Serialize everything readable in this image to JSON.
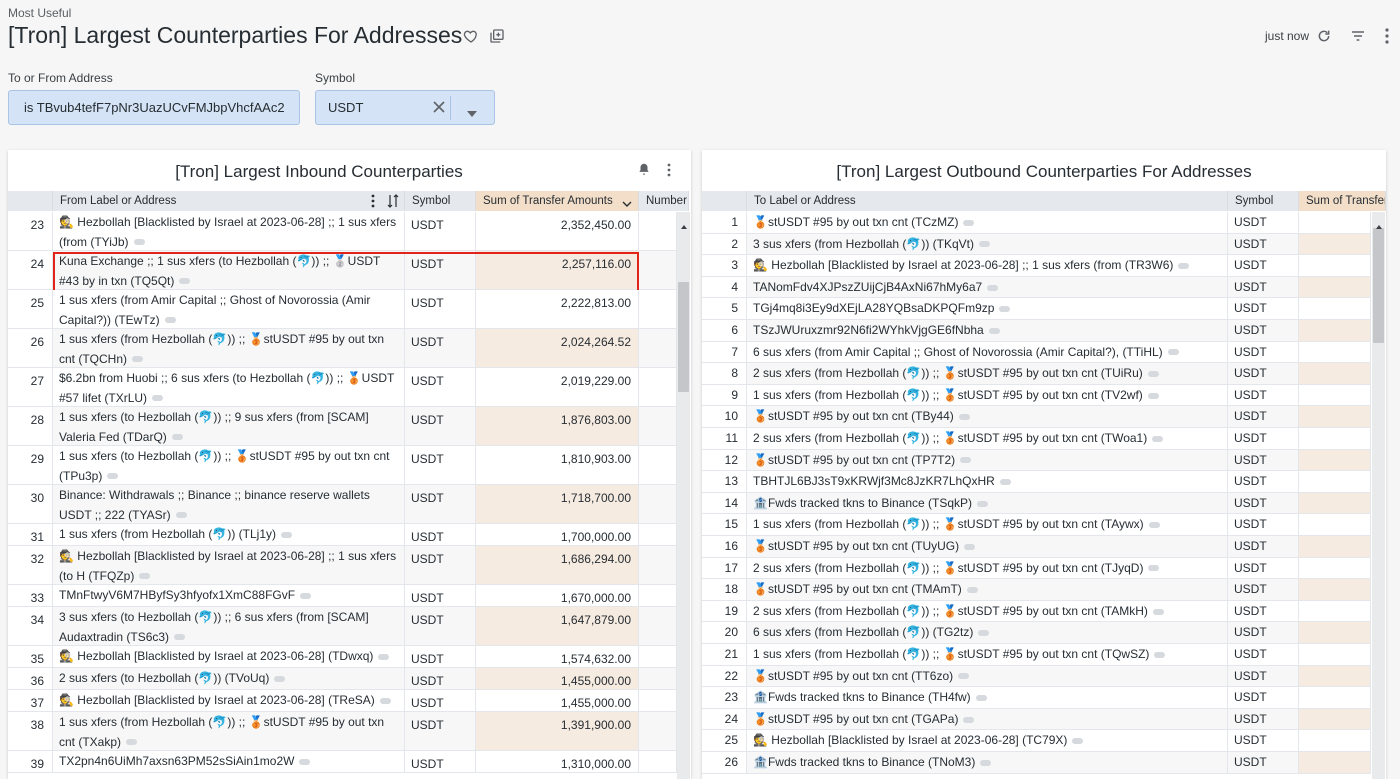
{
  "header": {
    "breadcrumb": "Most Useful",
    "title": "[Tron] Largest Counterparties For Addresses",
    "updated": "just now",
    "icons": [
      "heart-icon",
      "copy-icon",
      "refresh-icon",
      "filter-icon",
      "more-vert-icon"
    ]
  },
  "filters": {
    "address": {
      "label": "To or From Address",
      "value": "is TBvub4tefF7pNr3UazUCvFMJbpVhcfAAc2"
    },
    "symbol": {
      "label": "Symbol",
      "value": "USDT"
    }
  },
  "inbound": {
    "title": "[Tron] Largest Inbound Counterparties",
    "columns": [
      "From Label or Address",
      "Symbol",
      "Sum of Transfer Amounts",
      "Number o"
    ],
    "rows": [
      {
        "i": "23",
        "label": "🕵 Hezbollah [Blacklisted by Israel at 2023-06-28] ;; 1 sus xfers (from (TYiJb)",
        "sym": "USDT",
        "amt": "2,352,450.00",
        "lines": 2
      },
      {
        "i": "24",
        "label": "Kuna Exchange ;; 1 sus xfers (to Hezbollah (🐬)) ;; 🥈USDT #43 by in txn (TQ5Qt)",
        "sym": "USDT",
        "amt": "2,257,116.00",
        "lines": 2
      },
      {
        "i": "25",
        "label": "1 sus xfers (from Amir Capital ;; Ghost of Novorossia (Amir Capital?)) (TEwTz)",
        "sym": "USDT",
        "amt": "2,222,813.00",
        "lines": 2
      },
      {
        "i": "26",
        "label": "1 sus xfers (from Hezbollah (🐬)) ;; 🥉stUSDT #95 by out txn cnt (TQCHn)",
        "sym": "USDT",
        "amt": "2,024,264.52",
        "lines": 2
      },
      {
        "i": "27",
        "label": "$6.2bn from Huobi ;; 6 sus xfers (to Hezbollah (🐬)) ;; 🥉USDT #57 lifet (TXrLU)",
        "sym": "USDT",
        "amt": "2,019,229.00",
        "lines": 2
      },
      {
        "i": "28",
        "label": "1 sus xfers (to Hezbollah (🐬)) ;; 9 sus xfers (from [SCAM] Valeria Fed (TDarQ)",
        "sym": "USDT",
        "amt": "1,876,803.00",
        "lines": 2
      },
      {
        "i": "29",
        "label": "1 sus xfers (to Hezbollah (🐬)) ;; 🥉stUSDT #95 by out txn cnt (TPu3p)",
        "sym": "USDT",
        "amt": "1,810,903.00",
        "lines": 2
      },
      {
        "i": "30",
        "label": "Binance: Withdrawals ;; Binance ;; binance reserve wallets USDT ;; 222 (TYASr)",
        "sym": "USDT",
        "amt": "1,718,700.00",
        "lines": 2
      },
      {
        "i": "31",
        "label": "1 sus xfers (from Hezbollah (🐬)) (TLj1y)",
        "sym": "USDT",
        "amt": "1,700,000.00",
        "lines": 1
      },
      {
        "i": "32",
        "label": "🕵 Hezbollah [Blacklisted by Israel at 2023-06-28] ;; 1 sus xfers (to H (TFQZp)",
        "sym": "USDT",
        "amt": "1,686,294.00",
        "lines": 2
      },
      {
        "i": "33",
        "label": "TMnFtwyV6M7HByfSy3hfyofx1XmC88FGvF",
        "sym": "USDT",
        "amt": "1,670,000.00",
        "lines": 1
      },
      {
        "i": "34",
        "label": "3 sus xfers (to Hezbollah (🐬)) ;; 6 sus xfers (from [SCAM] Audaxtradin (TS6c3)",
        "sym": "USDT",
        "amt": "1,647,879.00",
        "lines": 2
      },
      {
        "i": "35",
        "label": "🕵 Hezbollah [Blacklisted by Israel at 2023-06-28] (TDwxq)",
        "sym": "USDT",
        "amt": "1,574,632.00",
        "lines": 1
      },
      {
        "i": "36",
        "label": "2 sus xfers (to Hezbollah (🐬)) (TVoUq)",
        "sym": "USDT",
        "amt": "1,455,000.00",
        "lines": 1
      },
      {
        "i": "37",
        "label": "🕵 Hezbollah [Blacklisted by Israel at 2023-06-28] (TReSA)",
        "sym": "USDT",
        "amt": "1,455,000.00",
        "lines": 1
      },
      {
        "i": "38",
        "label": "1 sus xfers (from Hezbollah (🐬)) ;; 🥉stUSDT #95 by out txn cnt (TXakp)",
        "sym": "USDT",
        "amt": "1,391,900.00",
        "lines": 2
      },
      {
        "i": "39",
        "label": "TX2pn4n6UiMh7axsn63PM52sSiAin1mo2W",
        "sym": "USDT",
        "amt": "1,310,000.00",
        "lines": 1
      }
    ]
  },
  "outbound": {
    "title": "[Tron] Largest Outbound Counterparties For Addresses",
    "columns": [
      "To Label or Address",
      "Symbol",
      "Sum of Transfer"
    ],
    "rows": [
      {
        "i": "1",
        "label": "🥉stUSDT #95 by out txn cnt (TCzMZ)",
        "sym": "USDT"
      },
      {
        "i": "2",
        "label": "3 sus xfers (from Hezbollah (🐬)) (TKqVt)",
        "sym": "USDT"
      },
      {
        "i": "3",
        "label": "🕵 Hezbollah [Blacklisted by Israel at 2023-06-28] ;; 1 sus xfers (from (TR3W6)",
        "sym": "USDT"
      },
      {
        "i": "4",
        "label": "TANomFdv4XJPszZUijCjB4AxNi67hMy6a7",
        "sym": "USDT"
      },
      {
        "i": "5",
        "label": "TGj4mq8i3Ey9dXEjLA28YQBsaDKPQFm9zp",
        "sym": "USDT"
      },
      {
        "i": "6",
        "label": "TSzJWUruxzmr92N6fi2WYhkVjgGE6fNbha",
        "sym": "USDT"
      },
      {
        "i": "7",
        "label": "6 sus xfers (from Amir Capital ;; Ghost of Novorossia (Amir Capital?), (TTiHL)",
        "sym": "USDT"
      },
      {
        "i": "8",
        "label": "2 sus xfers (from Hezbollah (🐬)) ;; 🥉stUSDT #95 by out txn cnt (TUiRu)",
        "sym": "USDT"
      },
      {
        "i": "9",
        "label": "1 sus xfers (from Hezbollah (🐬)) ;; 🥉stUSDT #95 by out txn cnt (TV2wf)",
        "sym": "USDT"
      },
      {
        "i": "10",
        "label": "🥉stUSDT #95 by out txn cnt (TBy44)",
        "sym": "USDT"
      },
      {
        "i": "11",
        "label": "2 sus xfers (from Hezbollah (🐬)) ;; 🥉stUSDT #95 by out txn cnt (TWoa1)",
        "sym": "USDT"
      },
      {
        "i": "12",
        "label": "🥉stUSDT #95 by out txn cnt (TP7T2)",
        "sym": "USDT"
      },
      {
        "i": "13",
        "label": "TBHTJL6BJ3sT9xKRWjf3Mc8JzKR7LhQxHR",
        "sym": "USDT"
      },
      {
        "i": "14",
        "label": "🏦Fwds tracked tkns to Binance (TSqkP)",
        "sym": "USDT"
      },
      {
        "i": "15",
        "label": "1 sus xfers (from Hezbollah (🐬)) ;; 🥉stUSDT #95 by out txn cnt (TAywx)",
        "sym": "USDT"
      },
      {
        "i": "16",
        "label": "🥉stUSDT #95 by out txn cnt (TUyUG)",
        "sym": "USDT"
      },
      {
        "i": "17",
        "label": "2 sus xfers (from Hezbollah (🐬)) ;; 🥉stUSDT #95 by out txn cnt (TJyqD)",
        "sym": "USDT"
      },
      {
        "i": "18",
        "label": "🥉stUSDT #95 by out txn cnt (TMAmT)",
        "sym": "USDT"
      },
      {
        "i": "19",
        "label": "2 sus xfers (from Hezbollah (🐬)) ;; 🥉stUSDT #95 by out txn cnt (TAMkH)",
        "sym": "USDT"
      },
      {
        "i": "20",
        "label": "6 sus xfers (from Hezbollah (🐬)) (TG2tz)",
        "sym": "USDT"
      },
      {
        "i": "21",
        "label": "1 sus xfers (from Hezbollah (🐬)) ;; 🥉stUSDT #95 by out txn cnt (TQwSZ)",
        "sym": "USDT"
      },
      {
        "i": "22",
        "label": "🥉stUSDT #95 by out txn cnt (TT6zo)",
        "sym": "USDT"
      },
      {
        "i": "23",
        "label": "🏦Fwds tracked tkns to Binance (TH4fw)",
        "sym": "USDT"
      },
      {
        "i": "24",
        "label": "🥉stUSDT #95 by out txn cnt (TGAPa)",
        "sym": "USDT"
      },
      {
        "i": "25",
        "label": "🕵 Hezbollah [Blacklisted by Israel at 2023-06-28] (TC79X)",
        "sym": "USDT"
      },
      {
        "i": "26",
        "label": "🏦Fwds tracked tkns to Binance (TNoM3)",
        "sym": "USDT"
      }
    ]
  },
  "colors": {
    "accent": "#d4e3f5",
    "sum_column": "#f3dfc9",
    "highlight": "#e2231a"
  }
}
